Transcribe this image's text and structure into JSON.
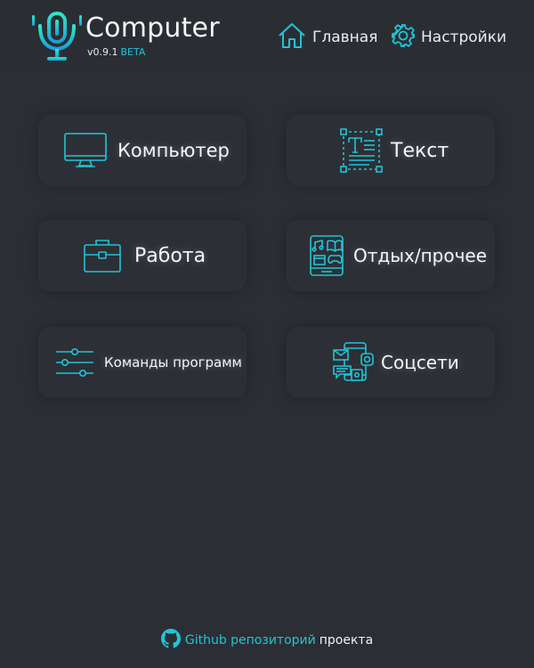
{
  "brand": {
    "title": "Computer",
    "version": "v0.9.1",
    "badge": "BETA",
    "logo_icon": "microphone-icon"
  },
  "nav": {
    "home": {
      "label": "Главная",
      "icon": "home-icon"
    },
    "settings": {
      "label": "Настройки",
      "icon": "gear-icon"
    }
  },
  "tiles": [
    {
      "label": "Компьютер",
      "icon": "monitor-icon"
    },
    {
      "label": "Текст",
      "icon": "text-frame-icon"
    },
    {
      "label": "Работа",
      "icon": "briefcase-icon"
    },
    {
      "label": "Отдых/прочее",
      "icon": "tablet-media-icon"
    },
    {
      "label": "Команды программ",
      "icon": "sliders-icon"
    },
    {
      "label": "Соцсети",
      "icon": "social-phone-icon"
    }
  ],
  "footer": {
    "repo_text": "Github репозиторий",
    "project_text": "проекта",
    "icon": "github-icon"
  },
  "colors": {
    "background": "#2b2f35",
    "tile": "#2c3036",
    "accent": "#22c3d6",
    "text": "#f4f6f8"
  }
}
